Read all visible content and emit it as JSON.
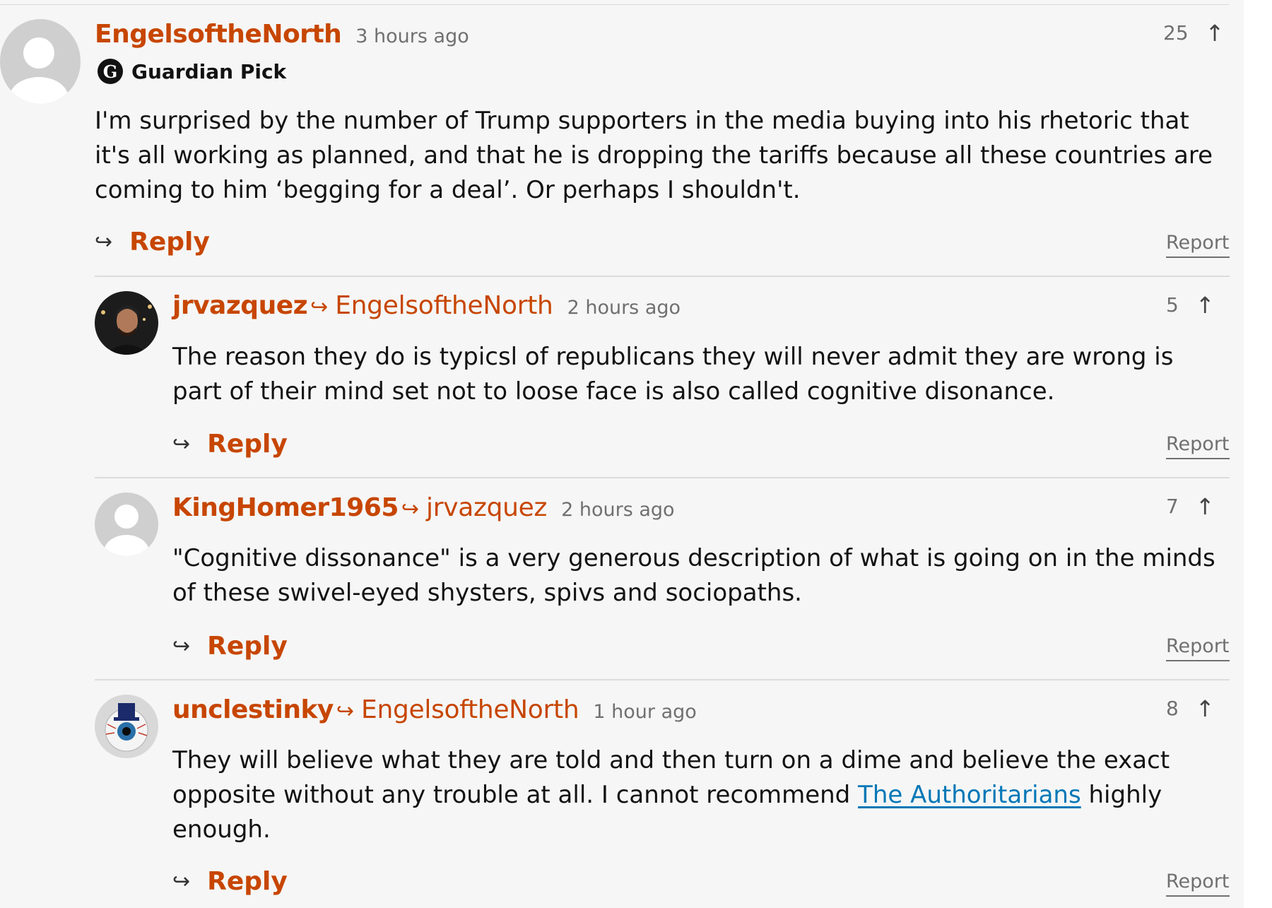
{
  "comments": [
    {
      "author": "EngelsoftheNorth",
      "reply_to": "",
      "timestamp": "3 hours ago",
      "badge": "Guardian Pick",
      "badge_icon": "guardian-g",
      "votes": "25",
      "body": "I'm surprised by the number of Trump supporters in the media buying into his rhetoric that it's all working as planned, and that he is dropping the tariffs because all these countries are coming to him ‘begging for a deal’. Or perhaps I shouldn't.",
      "reply_label": "Reply",
      "report_label": "Report",
      "avatar": "default-avatar"
    },
    {
      "author": "jrvazquez",
      "reply_to": "EngelsoftheNorth",
      "timestamp": "2 hours ago",
      "votes": "5",
      "body": "The reason they do is typicsl of republicans they will never admit they are wrong is part of their mind set not to loose face is also called cognitive disonance.",
      "reply_label": "Reply",
      "report_label": "Report",
      "avatar": "photo-avatar"
    },
    {
      "author": "KingHomer1965",
      "reply_to": "jrvazquez",
      "timestamp": "2 hours ago",
      "votes": "7",
      "body": "\"Cognitive dissonance\" is a very generous description of what is going on in the minds of these swivel-eyed shysters, spivs and sociopaths.",
      "reply_label": "Reply",
      "report_label": "Report",
      "avatar": "default-avatar"
    },
    {
      "author": "unclestinky",
      "reply_to": "EngelsoftheNorth",
      "timestamp": "1 hour ago",
      "votes": "8",
      "body_before": "They will believe what they are told and then turn on a dime and believe the exact opposite without any trouble at all. I cannot recommend ",
      "body_link": "The Authoritarians",
      "body_after": " highly enough.",
      "reply_label": "Reply",
      "report_label": "Report",
      "avatar": "eyeball-avatar"
    }
  ],
  "icons": {
    "reply_arrow": "↪",
    "upvote": "↑"
  },
  "colors": {
    "author": "#c74600",
    "link": "#0077b6",
    "muted": "#707070",
    "background": "#f6f6f6"
  }
}
